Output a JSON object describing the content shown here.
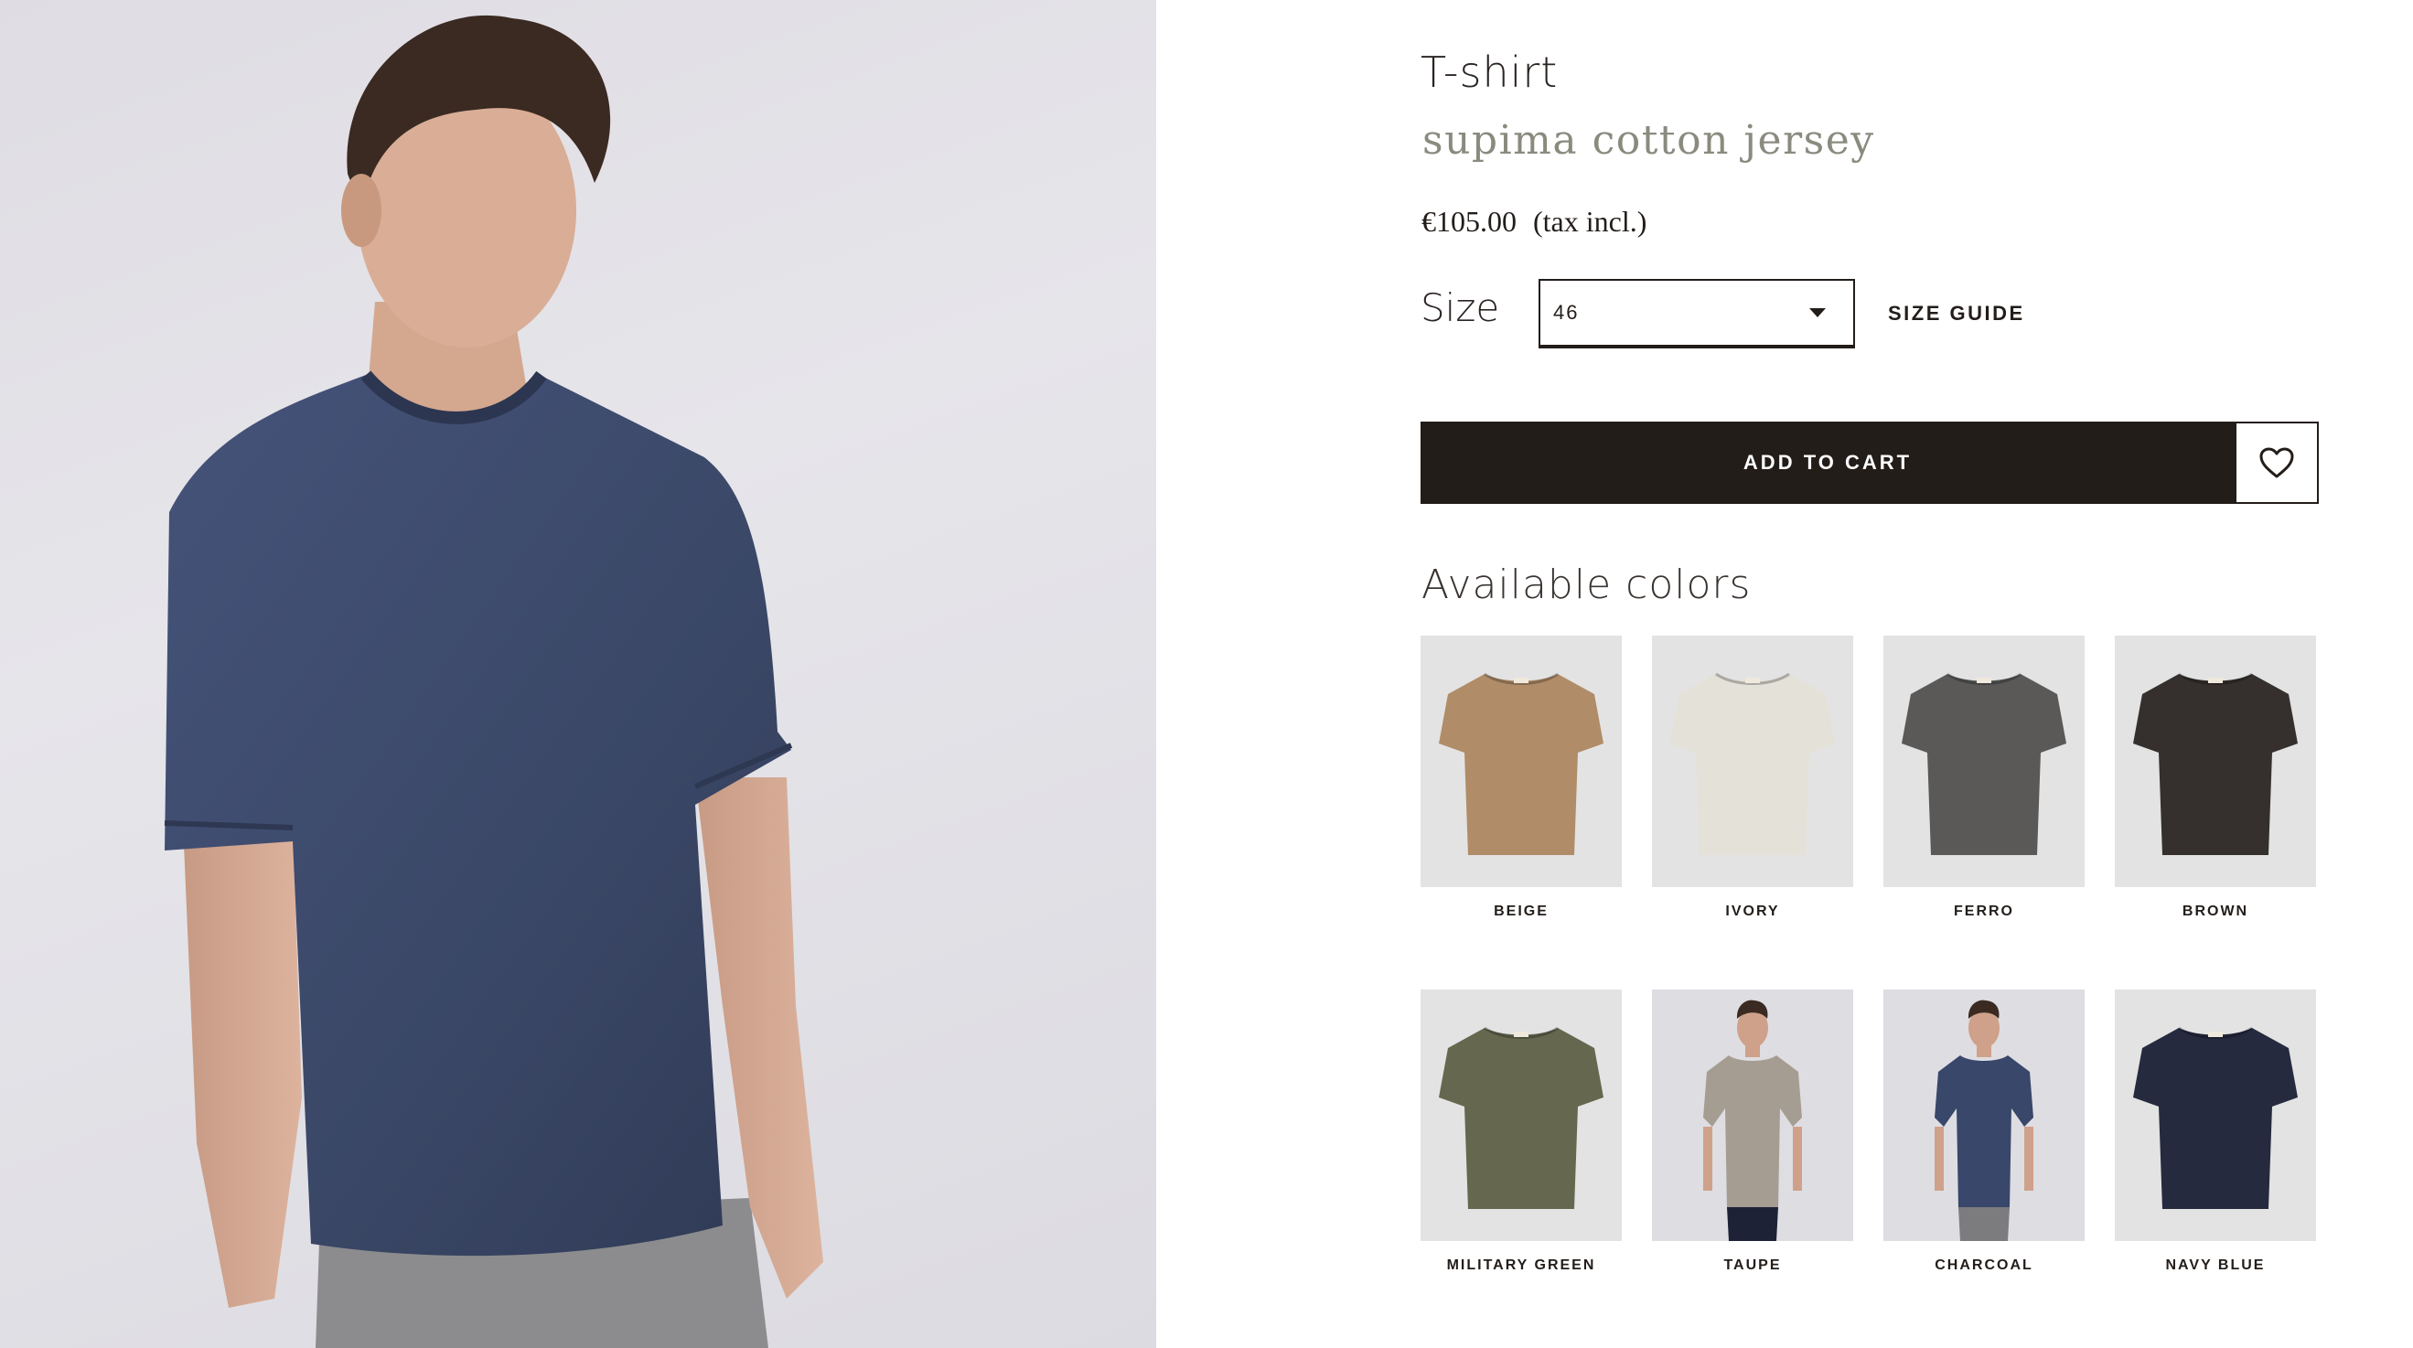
{
  "product": {
    "title": "T-shirt",
    "subtitle": "supima cotton jersey",
    "price": "€105.00",
    "tax_note": "(tax incl.)"
  },
  "size": {
    "label": "Size",
    "selected": "46",
    "guide_label": "SIZE GUIDE"
  },
  "actions": {
    "add_to_cart": "ADD TO CART",
    "wishlist_icon": "heart-icon"
  },
  "colors": {
    "title": "Available colors",
    "items": [
      {
        "label": "BEIGE",
        "hex": "#b08c68",
        "style": "flat"
      },
      {
        "label": "IVORY",
        "hex": "#e4e1d8",
        "style": "flat"
      },
      {
        "label": "FERRO",
        "hex": "#5a5958",
        "style": "flat"
      },
      {
        "label": "BROWN",
        "hex": "#35302d",
        "style": "flat"
      },
      {
        "label": "MILITARY GREEN",
        "hex": "#65684f",
        "style": "flat"
      },
      {
        "label": "TAUPE",
        "hex": "#a59d92",
        "style": "model"
      },
      {
        "label": "CHARCOAL",
        "hex": "#38476a",
        "style": "model"
      },
      {
        "label": "NAVY BLUE",
        "hex": "#252a3e",
        "style": "flat"
      }
    ]
  },
  "hero": {
    "shirt_color": "#3b4866",
    "background": "#e2e1e6"
  }
}
